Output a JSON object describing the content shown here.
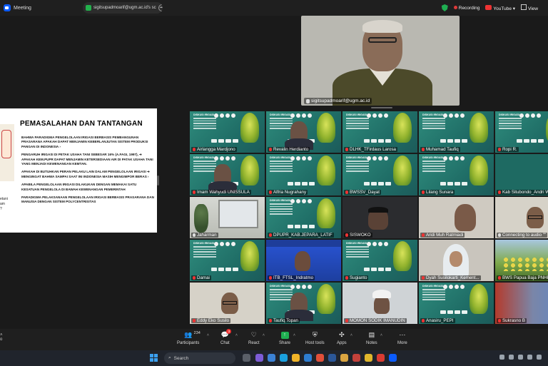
{
  "window": {
    "title": "Meeting",
    "share_banner": "sigitsupadmoarif@ugm.ac.id's sc",
    "recording": "Recording",
    "youtube": "YouTube",
    "view": "View"
  },
  "slide": {
    "title": "PEMASALAHAN DAN TANTANGAN",
    "left_text": [
      "etani",
      "am",
      "?"
    ],
    "paragraphs": [
      "BAHWA PARADIGMA PENGELOLAAN IRIGASI BERBASIS PEMBANGUNAN PRASARANA APAKAH DAPAT MENJAMIN KEBERLANJUTAN SISTEM PRODUKSI PANGAN DI INDONESIA ›",
      "PENGARUH IRIGASI DI PETAK USAHA TANI SEBESAR 16% (A.FAGI, 1997), ➔ APAKAH KEM.PUPR DAPAT MENJAMIN KETERSEDIAAN AIR DI PATAK USAHA TANI YANG MENJADI KEWENANGAN KEMTAN.",
      "APAKAH DI BUTUHKAN PERAN PELAKU LAIN DALAM PENGELOLAAN IRIGASI ➔ MENGINGAT BAHWA SAMPAI SAAT INI INDONESIA MASIH MENGIMPOR BERAS ›",
      "APABILA PENGELOLAAN IRIGASI DILAKUKAN DENGAN MEMAKAI SATU KESATUAN PENGELOLA DI BAWAH KEWENANGAN PEMERINTAH",
      " PARADIGMA PELAKSANAAN PENGELOLAAN IRIGASI BERBASIS PRASARANA DAN MANUSIA DENGAN SISTEM POLYCENTRISITAS"
    ]
  },
  "speaker": {
    "name": "sigitsupadmoarif@ugm.ac.id"
  },
  "tile_header": "DISKUSI IRIGASI",
  "participants": [
    {
      "name": "Airlangga Mardjono",
      "kind": "teal",
      "muted": true
    },
    {
      "name": "Revalin Herdianto",
      "kind": "teal-person",
      "muted": true
    },
    {
      "name": "DLHK_TFirdaus Larosa",
      "kind": "teal",
      "muted": true
    },
    {
      "name": "Muhamad Taufiq",
      "kind": "teal",
      "muted": true
    },
    {
      "name": "Ropi R.",
      "kind": "teal",
      "muted": true
    },
    {
      "name": "Imam Wahyudi UNISSULA",
      "kind": "teal-person",
      "muted": true
    },
    {
      "name": "Alfria Nugrahany",
      "kind": "teal",
      "muted": true
    },
    {
      "name": "BWSSV_Dayat",
      "kind": "teal",
      "muted": true
    },
    {
      "name": "Lilang Sunara",
      "kind": "teal",
      "muted": true
    },
    {
      "name": "Kab Situbondo_Andri W",
      "kind": "avatar",
      "muted": true
    },
    {
      "name": "Jaharman",
      "kind": "photo-room",
      "muted": false
    },
    {
      "name": "DPUPR_KAB.JEPARA_LATIF",
      "kind": "teal",
      "muted": true
    },
    {
      "name": "SISWOKO",
      "kind": "dark-person",
      "muted": true
    },
    {
      "name": "Aridi Muh Ratmiadi",
      "kind": "light-person",
      "muted": true
    },
    {
      "name": "Connecting to audio \"\"",
      "kind": "room-person",
      "muted": false
    },
    {
      "name": "Damai",
      "kind": "teal",
      "muted": true
    },
    {
      "name": "ITB_FTSL_Indratmo",
      "kind": "blue-stage",
      "muted": true
    },
    {
      "name": "Sugianto",
      "kind": "teal",
      "muted": true
    },
    {
      "name": "Dyah Susilokarti_Kement...",
      "kind": "headscarf",
      "muted": true
    },
    {
      "name": "BWS Papua Baja PNHP",
      "kind": "garden",
      "muted": true
    },
    {
      "name": "Eddy Eko Susilo",
      "kind": "room-person",
      "muted": true
    },
    {
      "name": "Taufiq Topan",
      "kind": "teal-person",
      "muted": true
    },
    {
      "name": "MOMON SODIK IMANUDIN",
      "kind": "cap-person",
      "muted": true
    },
    {
      "name": "Anasiru_PEPI",
      "kind": "teal",
      "muted": true
    },
    {
      "name": "Sukrasno B",
      "kind": "redwall",
      "muted": true
    }
  ],
  "toolbar": {
    "left_label": "o",
    "participants_label": "Participants",
    "participants_count": "234",
    "chat_label": "Chat",
    "chat_badge": "3",
    "react_label": "React",
    "share_label": "Share",
    "host_tools_label": "Host tools",
    "apps_label": "Apps",
    "notes_label": "Notes",
    "more_label": "More"
  },
  "taskbar": {
    "search_placeholder": "Search"
  },
  "colors": {
    "accent": "#0b5cff",
    "tile_teal": "#1f6d66",
    "record_red": "#e03a3a",
    "share_green": "#1fae51"
  }
}
